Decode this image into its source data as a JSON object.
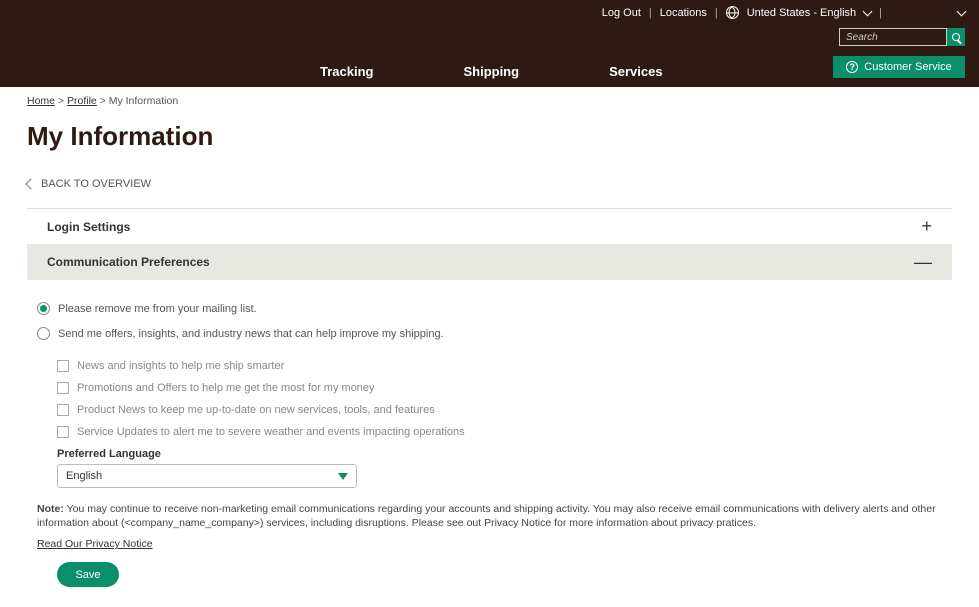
{
  "header": {
    "top_links": {
      "logout": "Log Out",
      "locations": "Locations",
      "locale": "Unted States - English"
    },
    "search_placeholder": "Search",
    "customer_service": "Customer Service",
    "nav": {
      "tracking": "Tracking",
      "shipping": "Shipping",
      "services": "Services"
    }
  },
  "breadcrumb": {
    "home": "Home",
    "profile": "Profile",
    "current": "My Information"
  },
  "page_title": "My Information",
  "back_link": "BACK TO OVERVIEW",
  "sections": {
    "login": "Login Settings",
    "comm": "Communication Preferences"
  },
  "prefs": {
    "radio_remove": "Please remove me from your mailing list.",
    "radio_send": "Send me offers, insights, and industry news that can help improve my shipping.",
    "check_news": "News and insights to help me ship smarter",
    "check_promo": "Promotions and Offers to help me get the most for my money",
    "check_product": "Product News to keep me up-to-date on new services, tools, and features",
    "check_service": "Service Updates to alert me to severe weather and events impacting operations",
    "lang_label": "Preferred Language",
    "lang_value": "English",
    "note_label": "Note:",
    "note_text": " You may continue to receive non-marketing email communications regarding your accounts and shipping activity. You may also receive email communications with delivery alerts and other information about (<company_name_company>) services, including disruptions. Please see out Privacy Notice for more information about privacy pratices.",
    "privacy_link": "Read Our Privacy Notice",
    "save": "Save"
  }
}
